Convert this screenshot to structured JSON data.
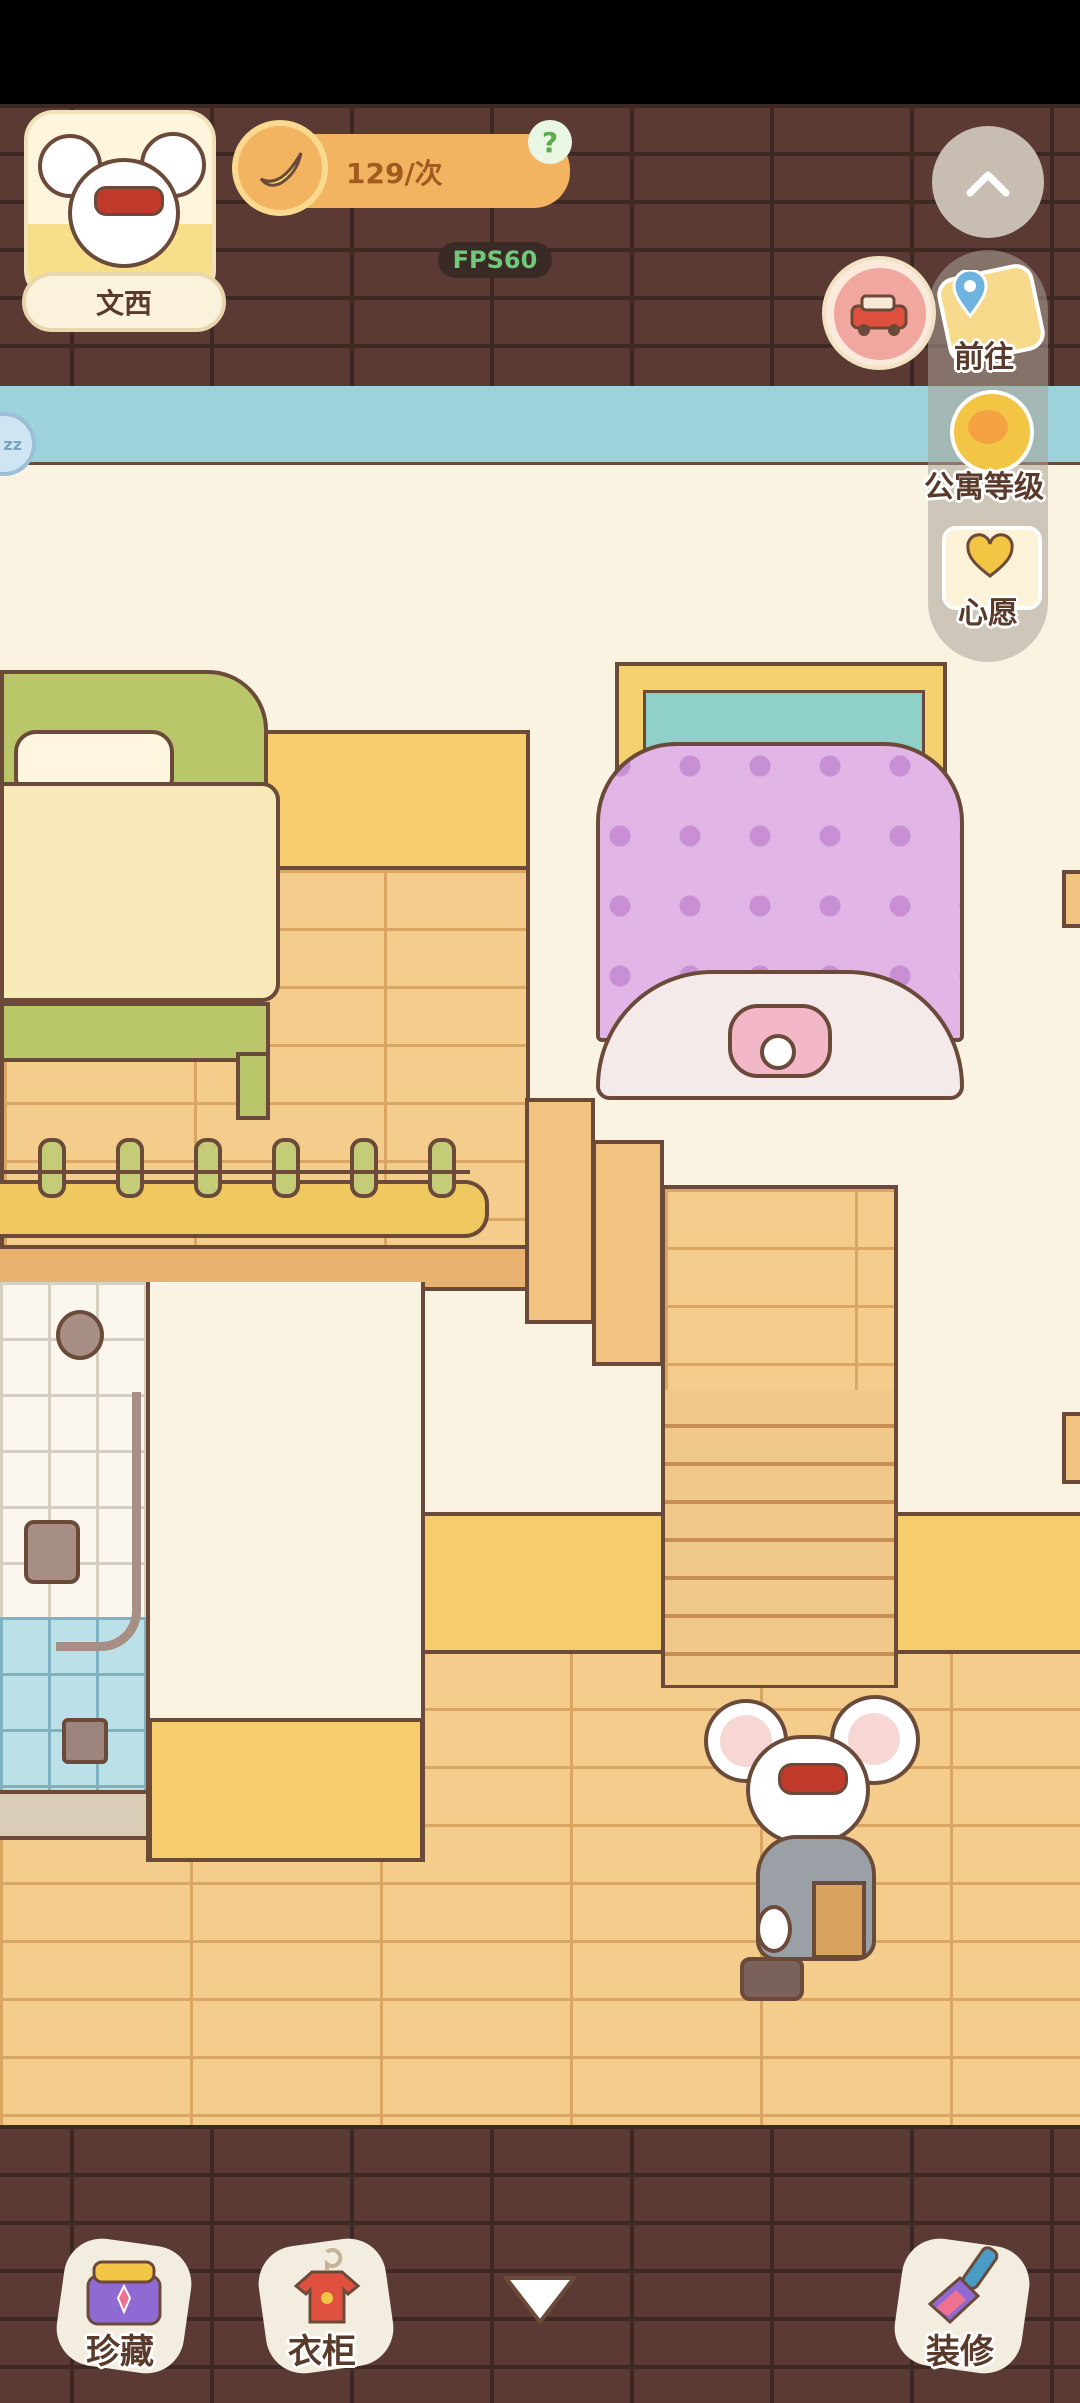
{
  "player": {
    "name": "文西"
  },
  "currency": {
    "rate": "129/次",
    "help": "?"
  },
  "fps": "FPS60",
  "side_menu": [
    {
      "label": "前往",
      "icon": "map-pin-icon"
    },
    {
      "label": "公寓等级",
      "icon": "apartment-level-icon"
    },
    {
      "label": "心愿",
      "icon": "heart-wish-icon"
    }
  ],
  "sleep_badge": "zz",
  "bottom_bar": {
    "collection": "珍藏",
    "wardrobe": "衣柜",
    "decorate": "装修"
  },
  "colors": {
    "accent": "#f3b462",
    "wall": "#fbf3e2",
    "brick": "#5a3a33",
    "sky": "#9bd2dc"
  }
}
